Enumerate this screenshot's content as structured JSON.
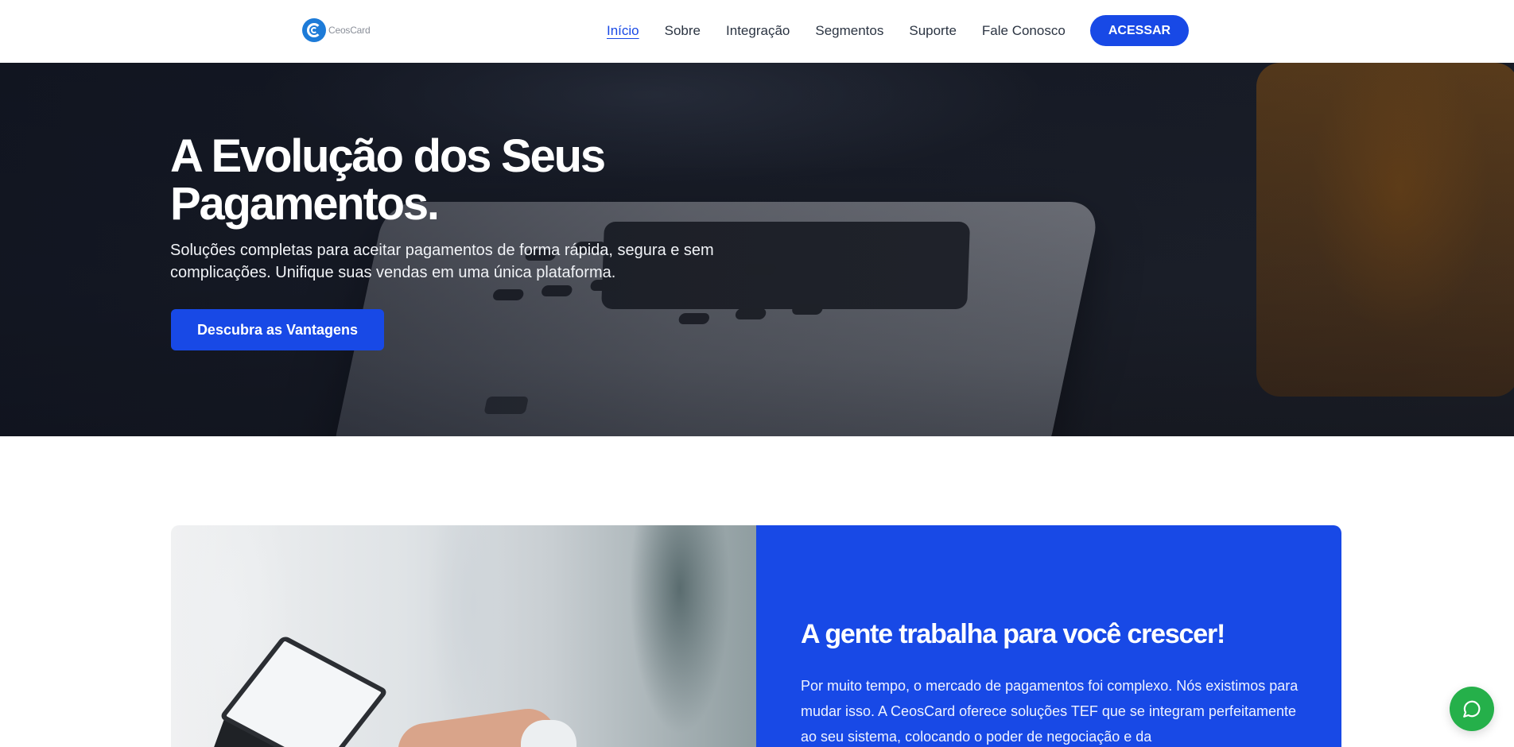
{
  "header": {
    "logo_text": "CeosCard",
    "nav": [
      {
        "label": "Início",
        "active": true
      },
      {
        "label": "Sobre",
        "active": false
      },
      {
        "label": "Integração",
        "active": false
      },
      {
        "label": "Segmentos",
        "active": false
      },
      {
        "label": "Suporte",
        "active": false
      },
      {
        "label": "Fale Conosco",
        "active": false
      }
    ],
    "cta_label": "ACESSAR"
  },
  "hero": {
    "title": "A Evolução dos Seus Pagamentos.",
    "subtitle": "Soluções completas para aceitar pagamentos de forma rápida, segura e sem complicações. Unifique suas vendas em uma única plataforma.",
    "button_label": "Descubra as Vantagens"
  },
  "about": {
    "title": "A gente trabalha para você crescer!",
    "text": "Por muito tempo, o mercado de pagamentos foi complexo. Nós existimos para mudar isso. A CeosCard oferece soluções TEF que se integram perfeitamente ao seu sistema, colocando o poder de negociação e da"
  },
  "colors": {
    "brand_blue": "#1849e6",
    "whatsapp_green": "#25b04a"
  },
  "icons": {
    "logo": "ceoscard-logo-icon",
    "chat": "whatsapp-chat-icon"
  }
}
